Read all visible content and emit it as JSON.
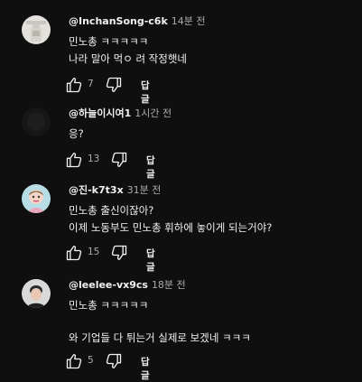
{
  "comments": [
    {
      "author": "@InchanSong-c6k",
      "time": "14분 전",
      "lines": [
        "민노총 ㅋㅋㅋㅋㅋ",
        "나라 말아 먹ㅇ 려 작정햇네"
      ],
      "likes": "7",
      "reply_label": "답글",
      "avatar_icon": "bottle-avatar-icon"
    },
    {
      "author": "@하늘이시여1",
      "time": "1시간 전",
      "lines": [
        "응?"
      ],
      "likes": "13",
      "reply_label": "답글",
      "avatar_icon": "dark-avatar-icon"
    },
    {
      "author": "@진-k7t3x",
      "time": "31분 전",
      "lines": [
        "민노총 출신이잖아?",
        "이제 노동부도 민노총 휘하에 놓이게 되는거야?"
      ],
      "likes": "15",
      "reply_label": "답글",
      "avatar_icon": "cartoon-avatar-icon"
    },
    {
      "author": "@leelee-vx9cs",
      "time": "18분 전",
      "lines": [
        "민노총 ㅋㅋㅋㅋㅋ",
        "와 기업들 다 튀는거 실제로 보겠네 ㅋㅋㅋ"
      ],
      "likes": "5",
      "reply_label": "답글",
      "avatar_icon": "person-avatar-icon"
    }
  ]
}
